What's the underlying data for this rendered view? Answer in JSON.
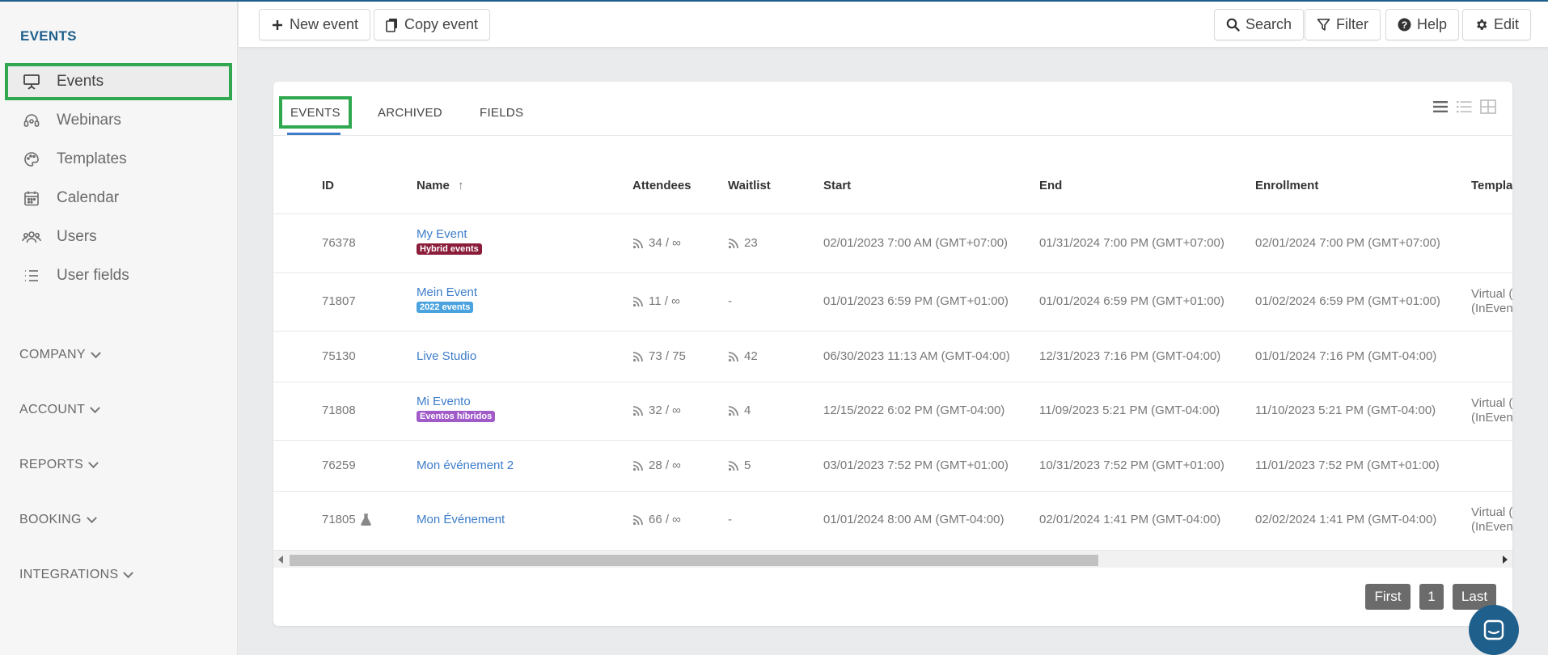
{
  "sidebar": {
    "title": "EVENTS",
    "items": [
      {
        "label": "Events",
        "icon": "presentation-icon"
      },
      {
        "label": "Webinars",
        "icon": "headset-icon"
      },
      {
        "label": "Templates",
        "icon": "palette-icon"
      },
      {
        "label": "Calendar",
        "icon": "calendar-icon"
      },
      {
        "label": "Users",
        "icon": "users-icon"
      },
      {
        "label": "User fields",
        "icon": "list-icon"
      }
    ],
    "sections": [
      "COMPANY",
      "ACCOUNT",
      "REPORTS",
      "BOOKING",
      "INTEGRATIONS"
    ]
  },
  "toolbar": {
    "new_event": "New event",
    "copy_event": "Copy event",
    "search": "Search",
    "filter": "Filter",
    "help": "Help",
    "edit": "Edit"
  },
  "tabs": [
    "EVENTS",
    "ARCHIVED",
    "FIELDS"
  ],
  "table": {
    "headers": [
      "ID",
      "Name",
      "Attendees",
      "Waitlist",
      "Start",
      "End",
      "Enrollment",
      "Templat"
    ],
    "rows": [
      {
        "id": "76378",
        "name": "My Event",
        "badge": "Hybrid events",
        "attendees": "34 / ∞",
        "waitlist": "23",
        "start": "02/01/2023 7:00 AM (GMT+07:00)",
        "end": "01/31/2024 7:00 PM (GMT+07:00)",
        "enrollment": "02/01/2024 7:00 PM (GMT+07:00)",
        "template_1": "",
        "template_2": ""
      },
      {
        "id": "71807",
        "name": "Mein Event",
        "badge": "2022 events",
        "attendees": "11 / ∞",
        "waitlist": "-",
        "start": "01/01/2023 6:59 PM (GMT+01:00)",
        "end": "01/01/2024 6:59 PM (GMT+01:00)",
        "enrollment": "01/02/2024 6:59 PM (GMT+01:00)",
        "template_1": "Virtual (",
        "template_2": "(InEvent"
      },
      {
        "id": "75130",
        "name": "Live Studio",
        "badge": "",
        "attendees": "73 / 75",
        "waitlist": "42",
        "start": "06/30/2023 11:13 AM (GMT-04:00)",
        "end": "12/31/2023 7:16 PM (GMT-04:00)",
        "enrollment": "01/01/2024 7:16 PM (GMT-04:00)",
        "template_1": "",
        "template_2": ""
      },
      {
        "id": "71808",
        "name": "Mi Evento",
        "badge": "Eventos híbridos",
        "attendees": "32 / ∞",
        "waitlist": "4",
        "start": "12/15/2022 6:02 PM (GMT-04:00)",
        "end": "11/09/2023 5:21 PM (GMT-04:00)",
        "enrollment": "11/10/2023 5:21 PM (GMT-04:00)",
        "template_1": "Virtual (",
        "template_2": "(InEvent"
      },
      {
        "id": "76259",
        "name": "Mon événement 2",
        "badge": "",
        "attendees": "28 / ∞",
        "waitlist": "5",
        "start": "03/01/2023 7:52 PM (GMT+01:00)",
        "end": "10/31/2023 7:52 PM (GMT+01:00)",
        "enrollment": "11/01/2023 7:52 PM (GMT+01:00)",
        "template_1": "",
        "template_2": ""
      },
      {
        "id": "71805",
        "name": "Mon Événement",
        "badge": "",
        "attendees": "66 / ∞",
        "waitlist": "-",
        "start": "01/01/2024 8:00 AM (GMT-04:00)",
        "end": "02/01/2024 1:41 PM (GMT-04:00)",
        "enrollment": "02/02/2024 1:41 PM (GMT-04:00)",
        "template_1": "Virtual (",
        "template_2": "(InEvent"
      }
    ]
  },
  "pager": {
    "first": "First",
    "page": "1",
    "last": "Last"
  },
  "colors": {
    "accent": "#3d7dca",
    "brand": "#1f5f8b",
    "highlight": "#2fa84f",
    "badge_hybrid": "#8b1d3b",
    "badge_2022": "#4aa3df",
    "badge_hibridos": "#a05bc9"
  }
}
